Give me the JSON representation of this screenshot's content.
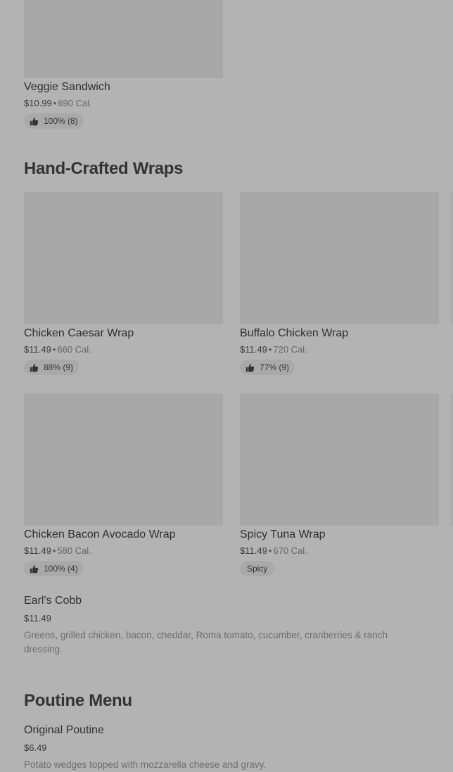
{
  "items": {
    "veggie": {
      "name": "Veggie Sandwich",
      "price": "$10.99",
      "calories": "690 Cal.",
      "rating": "100% (8)"
    },
    "caesar": {
      "name": "Chicken Caesar Wrap",
      "price": "$11.49",
      "calories": "660 Cal.",
      "rating": "88% (9)"
    },
    "buffalo": {
      "name": "Buffalo Chicken Wrap",
      "price": "$11.49",
      "calories": "720 Cal.",
      "rating": "77% (9)"
    },
    "bacon_avocado": {
      "name": "Chicken Bacon Avocado Wrap",
      "price": "$11.49",
      "calories": "580 Cal.",
      "rating": "100% (4)"
    },
    "spicy_tuna": {
      "name": "Spicy Tuna Wrap",
      "price": "$11.49",
      "calories": "670 Cal.",
      "tag": "Spicy"
    },
    "earls_cobb": {
      "name": "Earl's Cobb",
      "price": "$11.49",
      "description": "Greens, grilled chicken, bacon, cheddar, Roma tomato, cucumber, cranberries & ranch dressing."
    },
    "original_poutine": {
      "name": "Original Poutine",
      "price": "$6.49",
      "description": "Potato wedges topped with mozzarella cheese and gravy."
    }
  },
  "sections": {
    "wraps": "Hand-Crafted Wraps",
    "poutine": "Poutine Menu"
  },
  "separator": "•",
  "icons": {
    "rating": "thumbs-up-icon"
  },
  "colors": {
    "background": "#b3b3b3",
    "image_placeholder": "#a8a8a8",
    "badge": "#a9a9a9"
  }
}
